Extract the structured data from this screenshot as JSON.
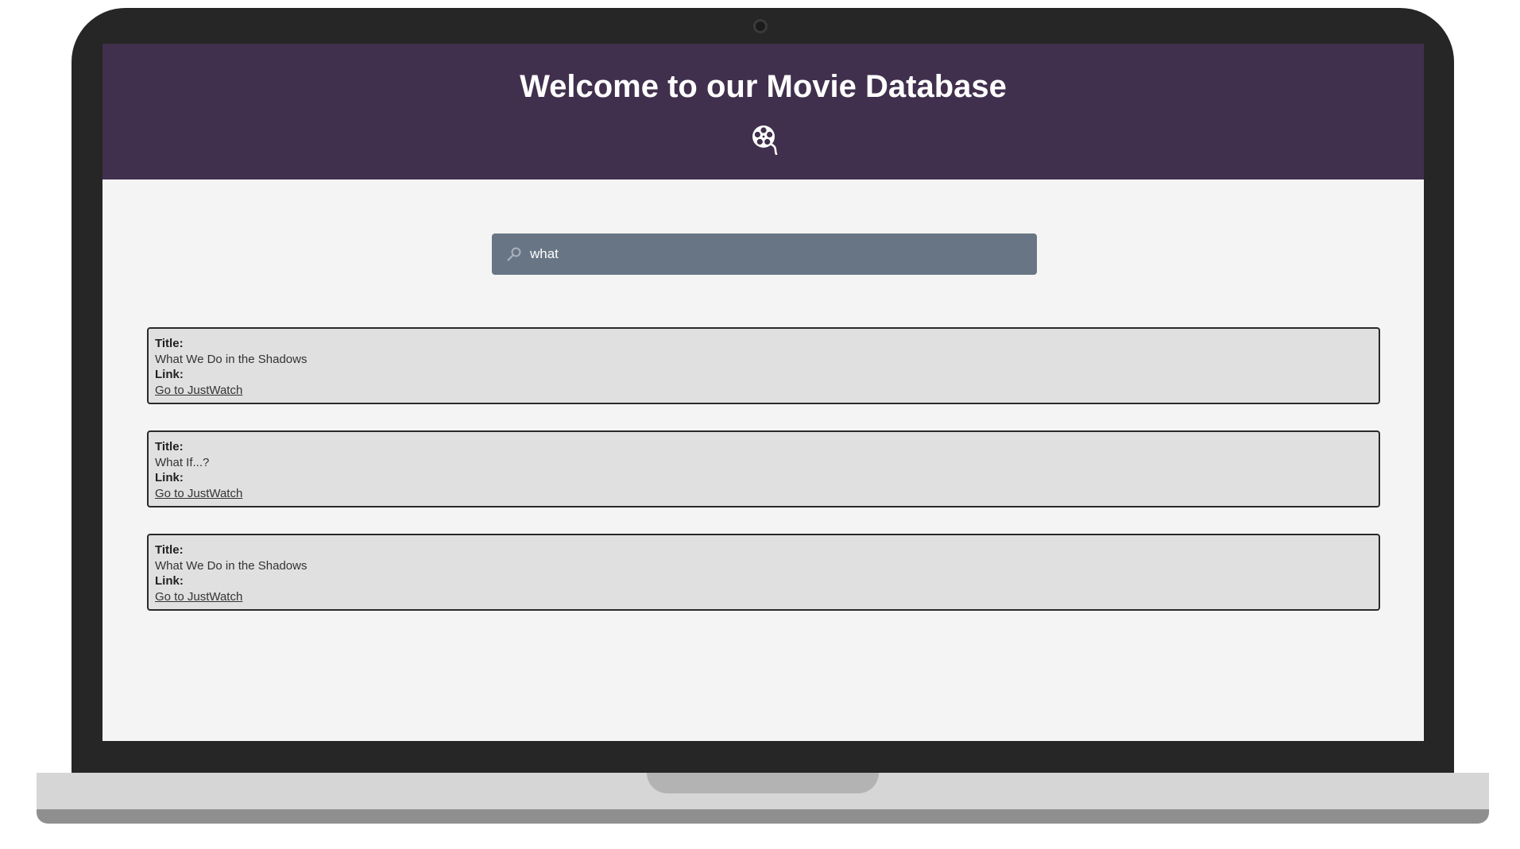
{
  "header": {
    "title": "Welcome to our Movie Database",
    "icon": "film-reel-icon"
  },
  "search": {
    "value": "what",
    "icon": "search-icon"
  },
  "results": [
    {
      "title_label": "Title:",
      "title": "What We Do in the Shadows",
      "link_label": "Link:",
      "link_text": "Go to JustWatch"
    },
    {
      "title_label": "Title:",
      "title": "What If...?",
      "link_label": "Link:",
      "link_text": "Go to JustWatch"
    },
    {
      "title_label": "Title:",
      "title": "What We Do in the Shadows",
      "link_label": "Link:",
      "link_text": "Go to JustWatch"
    }
  ],
  "colors": {
    "header_bg": "#40304d",
    "search_bg": "#687584",
    "card_bg": "#e0e0e0",
    "page_bg": "#f4f4f4"
  }
}
